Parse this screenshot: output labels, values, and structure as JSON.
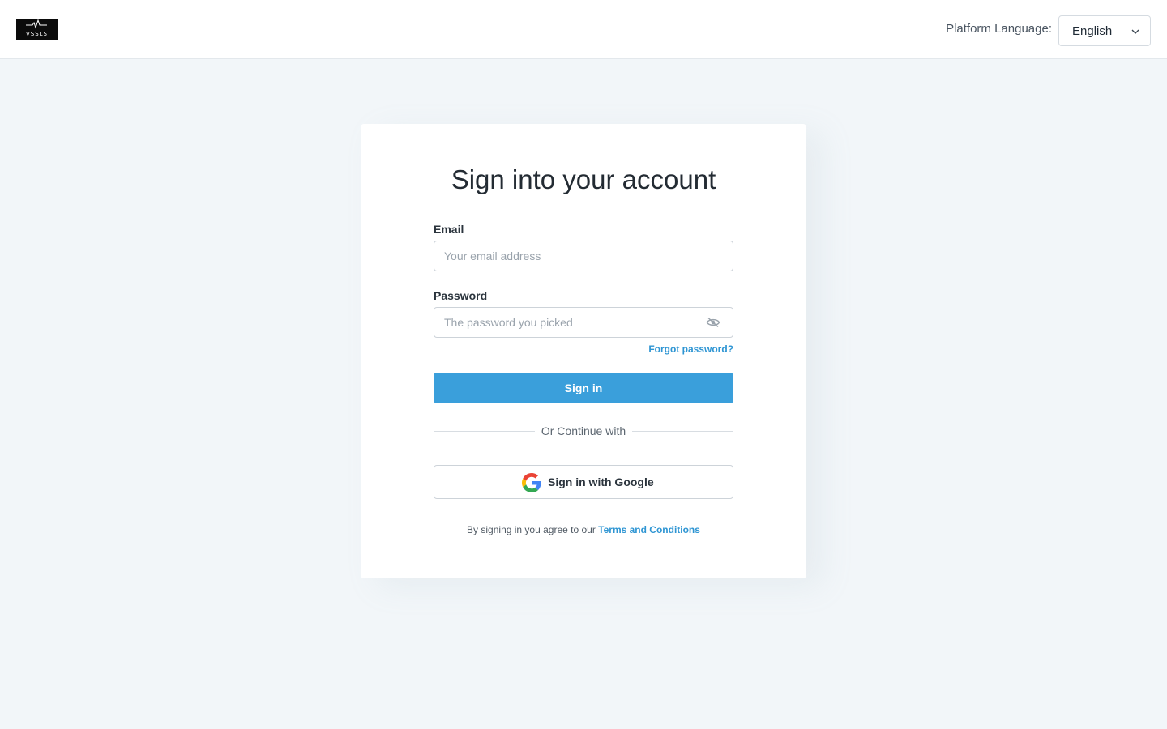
{
  "header": {
    "logo_text": "VSSLS",
    "language_label": "Platform Language:",
    "language_value": "English"
  },
  "form": {
    "title": "Sign into your account",
    "email_label": "Email",
    "email_placeholder": "Your email address",
    "email_value": "",
    "password_label": "Password",
    "password_placeholder": "The password you picked",
    "password_value": "",
    "forgot_link": "Forgot password?",
    "signin_button": "Sign in",
    "divider_text": "Or Continue with",
    "google_button": "Sign in with Google",
    "terms_prefix": "By signing in you agree to our",
    "terms_link": "Terms and Conditions"
  },
  "icons": {
    "logo": "pulse-line-logo",
    "language_dropdown": "chevron-down-icon",
    "password_toggle": "eye-slash-icon",
    "google": "google-g-icon"
  },
  "colors": {
    "accent": "#3a9fdb",
    "link": "#2e95d3",
    "background": "#f2f6f9"
  }
}
